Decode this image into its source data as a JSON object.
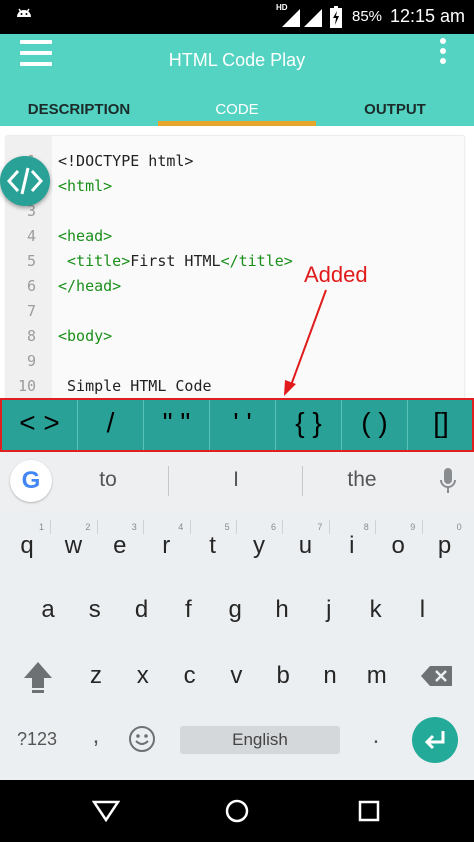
{
  "status_bar": {
    "network_label": "HD",
    "battery_percent": "85%",
    "time": "12:15 am",
    "icons": [
      "android-icon",
      "signal-icon",
      "signal-icon",
      "battery-charging-icon"
    ]
  },
  "app_bar": {
    "title": "HTML Code Play",
    "tabs": [
      {
        "label": "DESCRIPTION"
      },
      {
        "label": "CODE",
        "selected": true
      },
      {
        "label": "OUTPUT"
      }
    ],
    "colors": {
      "bar": "#54d3c2",
      "indicator": "#e6a62b"
    }
  },
  "editor": {
    "lines": [
      {
        "n": "1",
        "text": "<!DOCTYPE html>"
      },
      {
        "n": "2",
        "text": "<html>"
      },
      {
        "n": "3",
        "text": ""
      },
      {
        "n": "4",
        "text": "<head>"
      },
      {
        "n": "5",
        "text": " <title>First HTML</title>"
      },
      {
        "n": "6",
        "text": "</head>"
      },
      {
        "n": "7",
        "text": ""
      },
      {
        "n": "8",
        "text": "<body>"
      },
      {
        "n": "9",
        "text": ""
      },
      {
        "n": "10",
        "text": " Simple HTML Code"
      }
    ],
    "fab_icon": "code-brackets-icon"
  },
  "annotation": {
    "text": "Added",
    "color": "#e11b1b"
  },
  "symbol_bar": {
    "keys": [
      "< >",
      "/",
      "\" \"",
      "' '",
      "{ }",
      "( )",
      "[]"
    ],
    "color": "#2aa197"
  },
  "keyboard": {
    "suggestions": [
      "to",
      "I",
      "the"
    ],
    "row1": [
      "q",
      "w",
      "e",
      "r",
      "t",
      "y",
      "u",
      "i",
      "o",
      "p"
    ],
    "row1_hints": [
      "1",
      "2",
      "3",
      "4",
      "5",
      "6",
      "7",
      "8",
      "9",
      "0"
    ],
    "row2": [
      "a",
      "s",
      "d",
      "f",
      "g",
      "h",
      "j",
      "k",
      "l"
    ],
    "row3": [
      "z",
      "x",
      "c",
      "v",
      "b",
      "n",
      "m"
    ],
    "symbols_key": "?123",
    "comma_key": ",",
    "period_key": ".",
    "space_label": "English",
    "icons": [
      "google-logo-icon",
      "mic-icon",
      "shift-icon",
      "backspace-icon",
      "emoji-icon",
      "enter-icon"
    ]
  },
  "nav_bar": {
    "icons": [
      "back-icon",
      "home-icon",
      "recents-icon"
    ]
  }
}
